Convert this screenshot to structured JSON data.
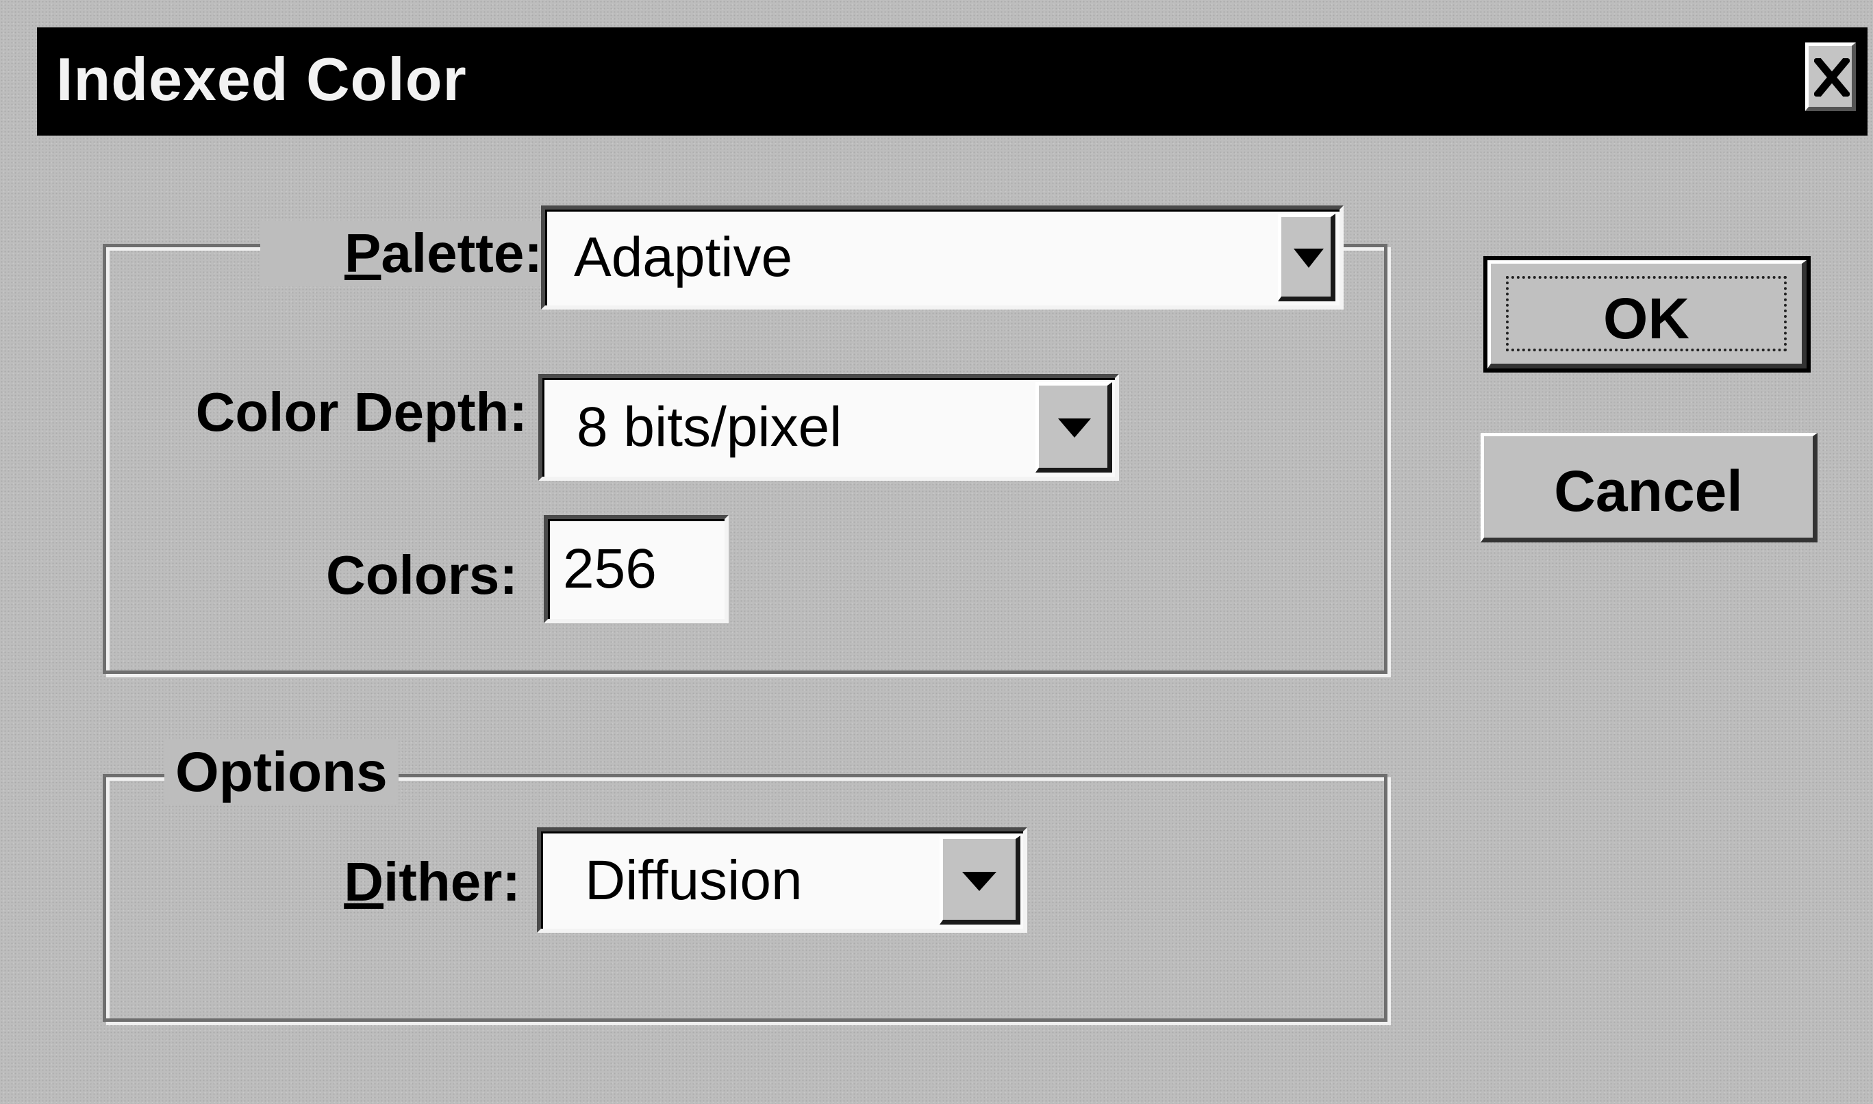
{
  "window": {
    "title": "Indexed Color",
    "close_icon": "close-icon"
  },
  "palette_group": {
    "palette": {
      "label_accel": "P",
      "label_rest": "alette:",
      "value": "Adaptive"
    },
    "color_depth": {
      "label": "Color Depth:",
      "value": "8 bits/pixel"
    },
    "colors": {
      "label": "Colors:",
      "value": "256"
    }
  },
  "options_group": {
    "legend": "Options",
    "dither": {
      "label_accel": "D",
      "label_rest": "ither:",
      "value": "Diffusion"
    }
  },
  "buttons": {
    "ok_label": "OK",
    "cancel_label": "Cancel"
  },
  "icons": {
    "dropdown": "chevron-down-icon"
  },
  "colors": {
    "titlebar_bg": "#000000",
    "title_text": "#f2f2f2",
    "dialog_bg": "#bdbdbd",
    "field_bg": "#fafafa"
  }
}
